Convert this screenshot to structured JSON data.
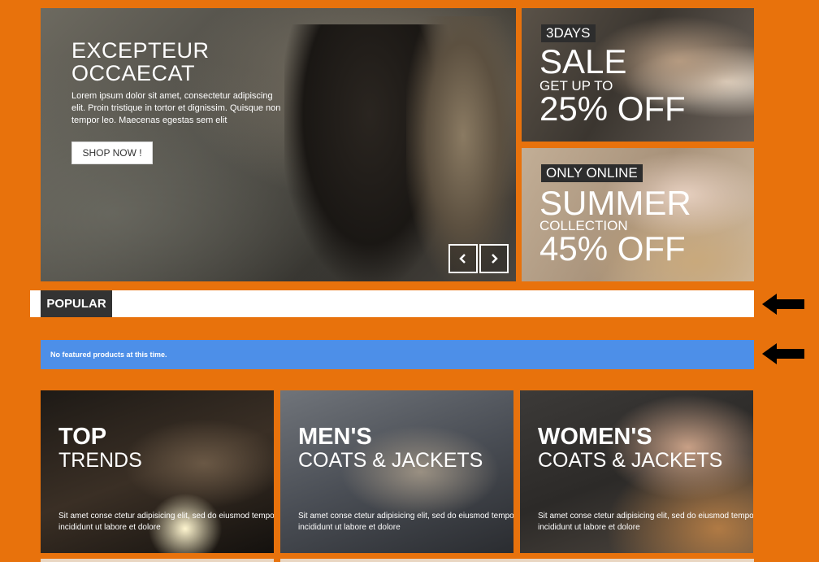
{
  "slider": {
    "title_line1": "EXCEPTEUR",
    "title_line2": "OCCAECAT",
    "description": "Lorem ipsum dolor sit amet, consectetur adipiscing elit. Proin tristique in tortor et dignissim. Quisque non tempor leo. Maecenas egestas sem elit",
    "button_label": "SHOP NOW !",
    "prev_icon": "chevron-left-icon",
    "next_icon": "chevron-right-icon"
  },
  "banners": [
    {
      "tag": "3DAYS",
      "headline": "SALE",
      "subline": "GET UP TO",
      "offer": "25% OFF"
    },
    {
      "tag": "ONLY ONLINE",
      "headline": "SUMMER",
      "subline": "COLLECTION",
      "offer": "45% OFF"
    }
  ],
  "popular": {
    "tab_label": "POPULAR"
  },
  "notice": {
    "text": "No featured products at this time."
  },
  "categories": [
    {
      "line1": "TOP",
      "line2": "TRENDS",
      "description": "Sit amet conse ctetur adipisicing elit, sed do eiusmod tempor incididunt ut labore et dolore"
    },
    {
      "line1": "MEN'S",
      "line2": "COATS & JACKETS",
      "description": "Sit amet conse ctetur adipisicing elit, sed do eiusmod tempor incididunt ut labore et dolore"
    },
    {
      "line1": "WOMEN'S",
      "line2": "COATS & JACKETS",
      "description": "Sit amet conse ctetur adipisicing elit, sed do eiusmod tempor incididunt ut labore et dolore"
    }
  ],
  "annotations": {
    "pointer_icon": "arrow-left-icon"
  },
  "colors": {
    "background": "#e8720c",
    "notice": "#4d8fe8",
    "tab": "#333333"
  }
}
